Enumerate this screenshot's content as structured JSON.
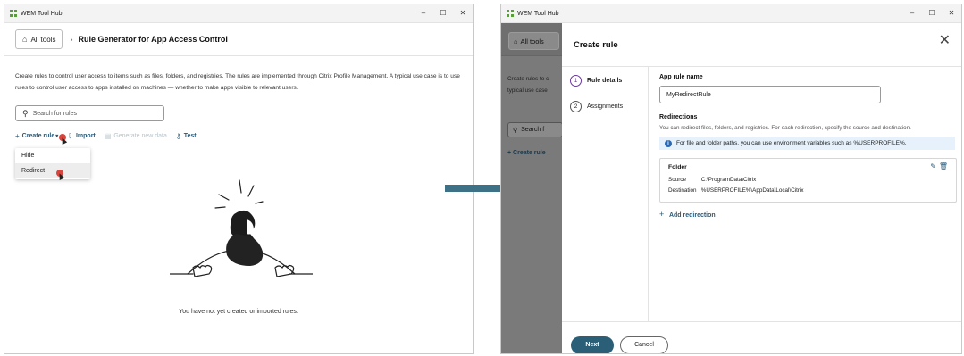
{
  "left_window": {
    "title": "WEM Tool Hub",
    "controls": [
      "–",
      "☐",
      "✕"
    ],
    "all_tools": "All tools",
    "page_title": "Rule Generator for App Access Control",
    "description": "Create rules to control user access to items such as files, folders, and registries. The rules are implemented through Citrix Profile Management. A typical use case is to use rules to control user access to apps installed on machines — whether to make apps visible to relevant users.",
    "search_placeholder": "Search for rules",
    "toolbar": {
      "create_rule": "Create rule",
      "import": "Import",
      "generate_new_data": "Generate new data",
      "test": "Test"
    },
    "menu": [
      "Hide",
      "Redirect"
    ],
    "empty_state": "You have not yet created or imported rules."
  },
  "right_window": {
    "title": "WEM Tool Hub",
    "controls": [
      "–",
      "☐",
      "✕"
    ],
    "background": {
      "all_tools": "All tools",
      "desc_line1": "Create rules to c",
      "desc_line2": "typical use case",
      "search": "Search f",
      "create_rule": "Create rule"
    },
    "panel": {
      "title": "Create rule",
      "steps": [
        {
          "num": "1",
          "label": "Rule details"
        },
        {
          "num": "2",
          "label": "Assignments"
        }
      ],
      "app_rule_name_label": "App rule name",
      "app_rule_name_value": "MyRedirectRule",
      "redirections_label": "Redirections",
      "redirections_help": "You can redirect files, folders, and registries. For each redirection, specify the source and destination.",
      "info_text": "For file and folder paths, you can use environment variables such as %USERPROFILE%.",
      "card": {
        "type": "Folder",
        "source_label": "Source",
        "source_value": "C:\\ProgramData\\Citrix",
        "destination_label": "Destination",
        "destination_value": "%USERPROFILE%\\AppData\\Local\\Citrix"
      },
      "add_redirection": "Add redirection",
      "next": "Next",
      "cancel": "Cancel"
    }
  },
  "colors": {
    "accent": "#2b5f78",
    "arrow": "#3f7186",
    "cursor_dot": "#d9443c",
    "info_bg": "#e6f1fb"
  }
}
